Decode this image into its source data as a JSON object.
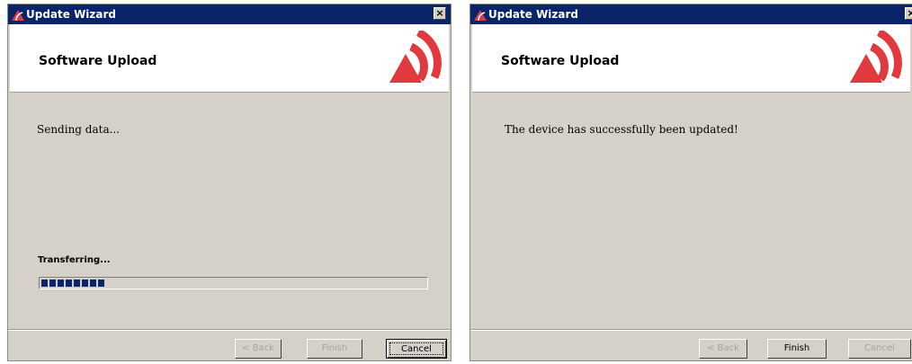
{
  "windows": [
    {
      "title": "Update Wizard",
      "close_glyph": "×",
      "heading": "Software Upload",
      "message": "Sending data...",
      "progress": {
        "label": "Transferring...",
        "value_percent": 18
      },
      "buttons": {
        "back": "< Back",
        "finish": "Finish",
        "cancel": "Cancel"
      },
      "button_states": {
        "back": "disabled",
        "finish": "disabled",
        "cancel": "default"
      }
    },
    {
      "title": "Update Wizard",
      "close_glyph": "×",
      "heading": "Software Upload",
      "message": "The device has successfully been updated!",
      "buttons": {
        "back": "< Back",
        "finish": "Finish",
        "cancel": "Cancel"
      },
      "button_states": {
        "back": "disabled",
        "finish": "enabled",
        "cancel": "disabled"
      }
    }
  ],
  "icons": {
    "app": "wireless-signal-icon",
    "logo": "wireless-signal-logo",
    "close": "close-icon"
  },
  "colors": {
    "titlebar": "#0a246a",
    "logo_red": "#e03a3e",
    "dialog_bg": "#d5d0c8",
    "progress_blue": "#0a246a"
  }
}
